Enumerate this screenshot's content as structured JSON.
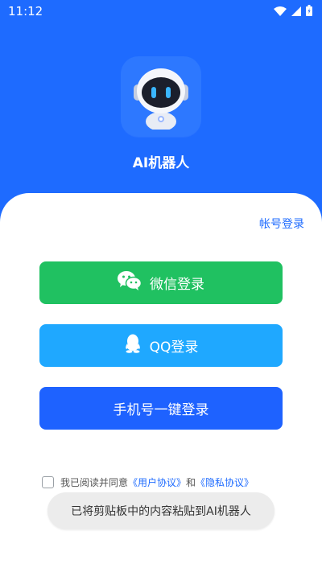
{
  "statusbar": {
    "time": "11:12",
    "icons": [
      "wifi-icon",
      "signal-icon",
      "battery-icon"
    ]
  },
  "app": {
    "name": "AI机器人",
    "logo_icon": "robot-icon"
  },
  "header": {
    "account_login_link": "帐号登录"
  },
  "buttons": {
    "wechat_label": "微信登录",
    "qq_label": "QQ登录",
    "phone_label": "手机号一键登录"
  },
  "agreement": {
    "prefix": "我已阅读并同意",
    "user_agreement": "《用户协议》",
    "and": "和",
    "privacy_agreement": "《隐私协议》",
    "checked": false
  },
  "toast": {
    "message": "已将剪贴板中的内容粘贴到AI机器人"
  },
  "colors": {
    "brand_blue": "#1E6BFF",
    "wechat_green": "#20C161",
    "qq_blue": "#1FA8FF",
    "phone_blue": "#1E62FF"
  }
}
